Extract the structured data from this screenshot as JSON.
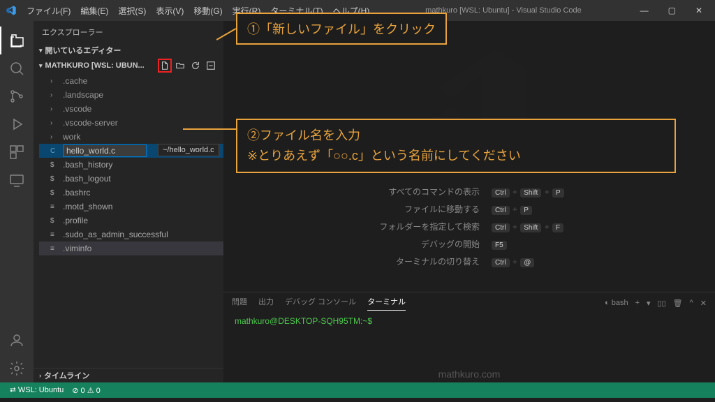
{
  "titlebar": {
    "menu": [
      "ファイル(F)",
      "編集(E)",
      "選択(S)",
      "表示(V)",
      "移動(G)",
      "実行(R)",
      "ターミナル(T)",
      "ヘルプ(H)"
    ],
    "title": "mathkuro [WSL: Ubuntu] - Visual Studio Code",
    "controls": {
      "min": "—",
      "max": "▢",
      "close": "✕"
    }
  },
  "sidebar": {
    "title": "エクスプローラー",
    "sections": {
      "open_editors": "開いているエディター",
      "folder": "MATHKURO [WSL: UBUN...",
      "timeline": "タイムライン"
    },
    "tree": [
      {
        "kind": "folder",
        "label": ".cache"
      },
      {
        "kind": "folder",
        "label": ".landscape"
      },
      {
        "kind": "folder",
        "label": ".vscode"
      },
      {
        "kind": "folder",
        "label": ".vscode-server"
      },
      {
        "kind": "folder",
        "label": "work"
      }
    ],
    "new_file_input": "hello_world.c",
    "new_file_tooltip": "~/hello_world.c",
    "files": [
      {
        "label": ".bash_history"
      },
      {
        "label": ".bash_logout"
      },
      {
        "label": ".bashrc"
      },
      {
        "label": ".motd_shown"
      },
      {
        "label": ".profile"
      },
      {
        "label": ".sudo_as_admin_successful"
      },
      {
        "label": ".viminfo"
      }
    ]
  },
  "welcome": {
    "hints": [
      {
        "label": "すべてのコマンドの表示",
        "keys": [
          "Ctrl",
          "Shift",
          "P"
        ]
      },
      {
        "label": "ファイルに移動する",
        "keys": [
          "Ctrl",
          "P"
        ]
      },
      {
        "label": "フォルダーを指定して検索",
        "keys": [
          "Ctrl",
          "Shift",
          "F"
        ]
      },
      {
        "label": "デバッグの開始",
        "keys": [
          "F5"
        ]
      },
      {
        "label": "ターミナルの切り替え",
        "keys": [
          "Ctrl",
          "@"
        ]
      }
    ]
  },
  "panel": {
    "tabs": [
      "問題",
      "出力",
      "デバッグ コンソール",
      "ターミナル"
    ],
    "active_tab": 3,
    "shell": "bash",
    "prompt": "mathkuro@DESKTOP-SQH95TM:~$"
  },
  "statusbar": {
    "remote": "WSL: Ubuntu",
    "problems": "⊘ 0  ⚠ 0"
  },
  "watermark": "mathkuro.com",
  "annotations": {
    "a1": "①「新しいファイル」をクリック",
    "a2": "②ファイル名を入力\n※とりあえず「○○.c」という名前にしてください"
  }
}
